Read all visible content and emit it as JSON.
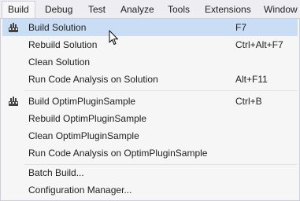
{
  "menubar": {
    "items": [
      {
        "label": "Build"
      },
      {
        "label": "Debug"
      },
      {
        "label": "Test"
      },
      {
        "label": "Analyze"
      },
      {
        "label": "Tools"
      },
      {
        "label": "Extensions"
      },
      {
        "label": "Window"
      }
    ]
  },
  "build_menu": {
    "groups": [
      [
        {
          "label": "Build Solution",
          "shortcut": "F7",
          "icon": "build-icon"
        },
        {
          "label": "Rebuild Solution",
          "shortcut": "Ctrl+Alt+F7"
        },
        {
          "label": "Clean Solution",
          "shortcut": ""
        },
        {
          "label": "Run Code Analysis on Solution",
          "shortcut": "Alt+F11"
        }
      ],
      [
        {
          "label": "Build OptimPluginSample",
          "shortcut": "Ctrl+B",
          "icon": "build-icon"
        },
        {
          "label": "Rebuild OptimPluginSample",
          "shortcut": ""
        },
        {
          "label": "Clean OptimPluginSample",
          "shortcut": ""
        },
        {
          "label": "Run Code Analysis on OptimPluginSample",
          "shortcut": ""
        }
      ],
      [
        {
          "label": "Batch Build...",
          "shortcut": ""
        },
        {
          "label": "Configuration Manager...",
          "shortcut": ""
        }
      ]
    ]
  },
  "colors": {
    "highlight": "#c9def5",
    "menu_background": "#f6f6f6",
    "menubar_background": "#eeeef2",
    "border": "#cccedb"
  }
}
